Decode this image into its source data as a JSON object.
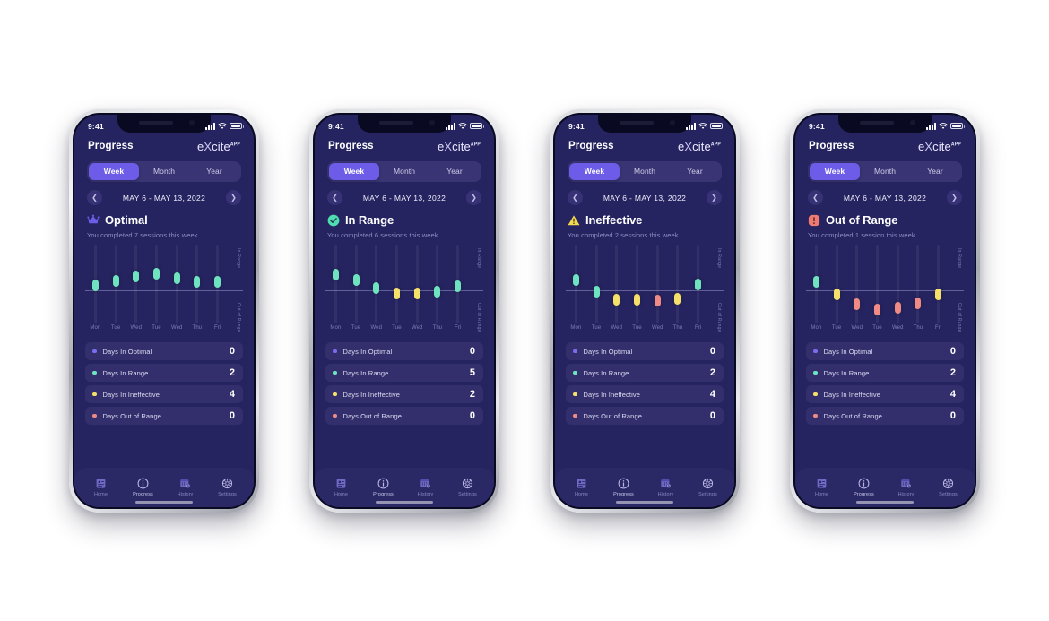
{
  "meta": {
    "colors": {
      "screen_bg": "#262460",
      "accent": "#6c5ce7",
      "optimal": "#7b6df0",
      "in_range": "#6fe3c0",
      "ineffective": "#f5e06a",
      "out_of_range": "#f08a84",
      "card": "#332f6d",
      "tabbar": "#2b2866"
    }
  },
  "status_bar": {
    "time": "9:41",
    "signal_icon": "cellular-signal-icon",
    "wifi_icon": "wifi-icon",
    "battery_icon": "battery-full-icon"
  },
  "header": {
    "title": "Progress",
    "logo_main": "e",
    "logo_x": "X",
    "logo_rest": "cite",
    "logo_sup": "APP"
  },
  "segments": [
    {
      "label": "Week",
      "active": true
    },
    {
      "label": "Month",
      "active": false
    },
    {
      "label": "Year",
      "active": false
    }
  ],
  "date_nav": {
    "prev_icon": "chevron-left-icon",
    "next_icon": "chevron-right-icon",
    "range": "MAY 6  - MAY 13, 2022"
  },
  "chart_axis": {
    "top_label": "In Range",
    "bottom_label": "Out of Range",
    "x_labels": [
      "Mon",
      "Tue",
      "Wed",
      "Tue",
      "Wed",
      "Thu",
      "Fri"
    ]
  },
  "summary_labels": {
    "optimal": "Days In Optimal",
    "in_range": "Days In Range",
    "ineffective": "Days In Ineffective",
    "out_of_range": "Days Out of Range"
  },
  "tabs": [
    {
      "label": "Home",
      "icon": "home-card-icon",
      "active": false
    },
    {
      "label": "Progress",
      "icon": "progress-info-icon",
      "active": true
    },
    {
      "label": "History",
      "icon": "history-calendar-icon",
      "active": false
    },
    {
      "label": "Settings",
      "icon": "settings-gear-icon",
      "active": false
    }
  ],
  "phones": [
    {
      "state_icon": "crown-icon",
      "state_title": "Optimal",
      "subtitle": "You completed 7 sessions this week",
      "summary_values": {
        "optimal": "0",
        "in_range": "2",
        "ineffective": "4",
        "out_of_range": "0"
      },
      "chart_data": {
        "type": "scatter",
        "title": "Optimal",
        "xlabel": "",
        "ylabel": "In Range / Out of Range",
        "categories": [
          "Mon",
          "Tue",
          "Wed",
          "Tue",
          "Wed",
          "Thu",
          "Fri"
        ],
        "ylim": [
          0,
          100
        ],
        "grid": false,
        "midline_at": 42,
        "points": [
          {
            "x": "Mon",
            "y": 56,
            "color": "#6fe3c0",
            "band": "in-range"
          },
          {
            "x": "Tue",
            "y": 61,
            "color": "#6fe3c0",
            "band": "in-range"
          },
          {
            "x": "Wed",
            "y": 67,
            "color": "#6fe3c0",
            "band": "in-range"
          },
          {
            "x": "Tue",
            "y": 70,
            "color": "#6fe3c0",
            "band": "in-range"
          },
          {
            "x": "Wed",
            "y": 65,
            "color": "#6fe3c0",
            "band": "in-range"
          },
          {
            "x": "Thu",
            "y": 60,
            "color": "#6fe3c0",
            "band": "in-range"
          },
          {
            "x": "Fri",
            "y": 60,
            "color": "#6fe3c0",
            "band": "in-range"
          }
        ]
      }
    },
    {
      "state_icon": "check-circle-icon",
      "state_title": "In Range",
      "subtitle": "You completed 6 sessions this week",
      "summary_values": {
        "optimal": "0",
        "in_range": "5",
        "ineffective": "2",
        "out_of_range": "0"
      },
      "chart_data": {
        "type": "scatter",
        "title": "In Range",
        "xlabel": "",
        "ylabel": "In Range / Out of Range",
        "categories": [
          "Mon",
          "Tue",
          "Wed",
          "Tue",
          "Wed",
          "Thu",
          "Fri"
        ],
        "ylim": [
          0,
          100
        ],
        "grid": false,
        "midline_at": 42,
        "points": [
          {
            "x": "Mon",
            "y": 69,
            "color": "#6fe3c0",
            "band": "in-range"
          },
          {
            "x": "Tue",
            "y": 62,
            "color": "#6fe3c0",
            "band": "in-range"
          },
          {
            "x": "Wed",
            "y": 52,
            "color": "#6fe3c0",
            "band": "in-range"
          },
          {
            "x": "Tue",
            "y": 45,
            "color": "#f5e06a",
            "band": "ineffective"
          },
          {
            "x": "Wed",
            "y": 45,
            "color": "#f5e06a",
            "band": "ineffective"
          },
          {
            "x": "Thu",
            "y": 48,
            "color": "#6fe3c0",
            "band": "in-range"
          },
          {
            "x": "Fri",
            "y": 55,
            "color": "#6fe3c0",
            "band": "in-range"
          }
        ]
      }
    },
    {
      "state_icon": "warning-triangle-icon",
      "state_title": "Ineffective",
      "subtitle": "You completed 2 sessions this week",
      "summary_values": {
        "optimal": "0",
        "in_range": "2",
        "ineffective": "4",
        "out_of_range": "0"
      },
      "chart_data": {
        "type": "scatter",
        "title": "Ineffective",
        "xlabel": "",
        "ylabel": "In Range / Out of Range",
        "categories": [
          "Mon",
          "Tue",
          "Wed",
          "Tue",
          "Wed",
          "Thu",
          "Fri"
        ],
        "ylim": [
          0,
          100
        ],
        "grid": false,
        "midline_at": 42,
        "points": [
          {
            "x": "Mon",
            "y": 62,
            "color": "#6fe3c0",
            "band": "in-range"
          },
          {
            "x": "Tue",
            "y": 48,
            "color": "#6fe3c0",
            "band": "in-range"
          },
          {
            "x": "Wed",
            "y": 38,
            "color": "#f5e06a",
            "band": "ineffective"
          },
          {
            "x": "Tue",
            "y": 38,
            "color": "#f5e06a",
            "band": "ineffective"
          },
          {
            "x": "Wed",
            "y": 36,
            "color": "#f08a84",
            "band": "out-of-range"
          },
          {
            "x": "Thu",
            "y": 39,
            "color": "#f5e06a",
            "band": "ineffective"
          },
          {
            "x": "Fri",
            "y": 57,
            "color": "#6fe3c0",
            "band": "in-range"
          }
        ]
      }
    },
    {
      "state_icon": "error-exclamation-icon",
      "state_title": "Out of Range",
      "subtitle": "You completed 1 session this week",
      "summary_values": {
        "optimal": "0",
        "in_range": "2",
        "ineffective": "4",
        "out_of_range": "0"
      },
      "chart_data": {
        "type": "scatter",
        "title": "Out of Range",
        "xlabel": "",
        "ylabel": "In Range / Out of Range",
        "categories": [
          "Mon",
          "Tue",
          "Wed",
          "Tue",
          "Wed",
          "Thu",
          "Fri"
        ],
        "ylim": [
          0,
          100
        ],
        "grid": false,
        "midline_at": 42,
        "points": [
          {
            "x": "Mon",
            "y": 60,
            "color": "#6fe3c0",
            "band": "in-range"
          },
          {
            "x": "Tue",
            "y": 44,
            "color": "#f5e06a",
            "band": "ineffective"
          },
          {
            "x": "Wed",
            "y": 32,
            "color": "#f08a84",
            "band": "out-of-range"
          },
          {
            "x": "Tue",
            "y": 25,
            "color": "#f08a84",
            "band": "out-of-range"
          },
          {
            "x": "Wed",
            "y": 27,
            "color": "#f08a84",
            "band": "out-of-range"
          },
          {
            "x": "Thu",
            "y": 33,
            "color": "#f08a84",
            "band": "out-of-range"
          },
          {
            "x": "Fri",
            "y": 44,
            "color": "#f5e06a",
            "band": "ineffective"
          }
        ]
      }
    }
  ]
}
